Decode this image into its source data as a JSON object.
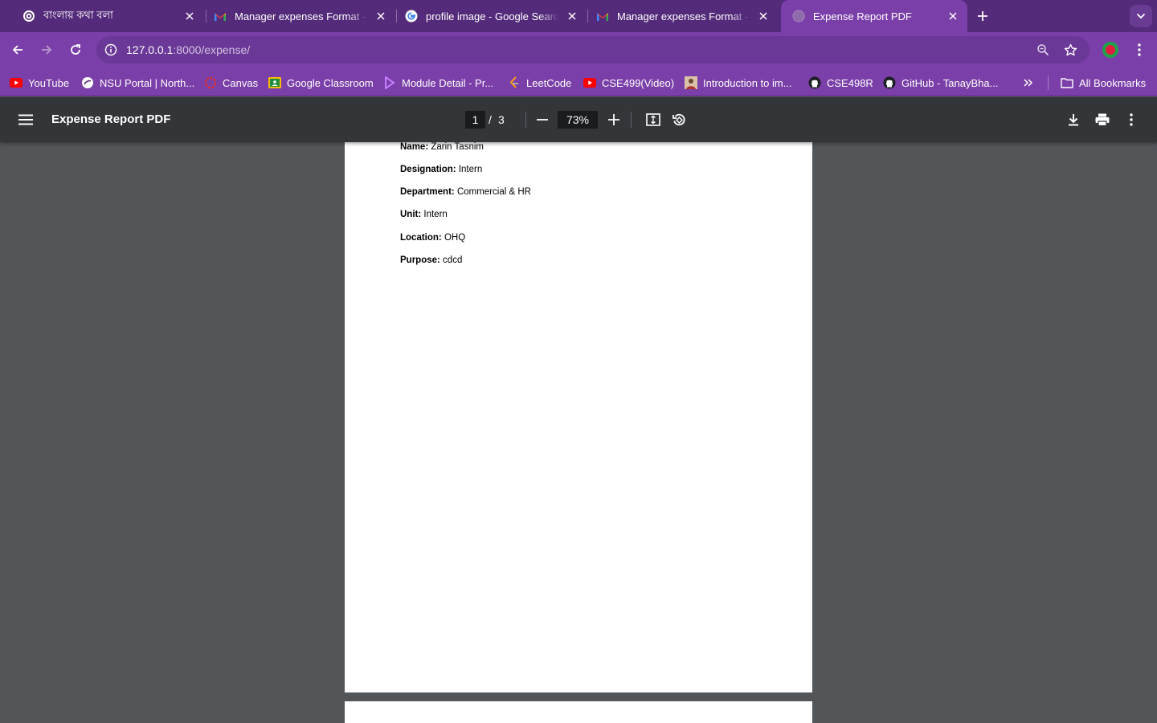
{
  "tabs": [
    {
      "title": "বাংলায় কথা বলা",
      "icon": "openai-icon",
      "active": false
    },
    {
      "title": "Manager expenses Format - p",
      "icon": "gmail-icon",
      "active": false
    },
    {
      "title": "profile image - Google Search",
      "icon": "google-icon",
      "active": false
    },
    {
      "title": "Manager expenses Format - p",
      "icon": "gmail-icon",
      "active": false
    },
    {
      "title": "Expense Report PDF",
      "icon": "globe-icon",
      "active": true
    }
  ],
  "address_bar": {
    "host": "127.0.0.1",
    "path": ":8000/expense/"
  },
  "bookmarks": [
    {
      "label": "YouTube",
      "icon": "youtube-icon"
    },
    {
      "label": "NSU Portal | North...",
      "icon": "nsu-icon"
    },
    {
      "label": "Canvas",
      "icon": "canvas-icon"
    },
    {
      "label": "Google Classroom",
      "icon": "classroom-icon"
    },
    {
      "label": "Module Detail - Pr...",
      "icon": "module-icon"
    },
    {
      "label": "LeetCode",
      "icon": "leetcode-icon"
    },
    {
      "label": "CSE499(Video)",
      "icon": "youtube-icon"
    },
    {
      "label": "Introduction to im...",
      "icon": "avatar-icon"
    },
    {
      "label": "CSE498R",
      "icon": "github-icon"
    },
    {
      "label": "GitHub - TanayBha...",
      "icon": "github-icon"
    }
  ],
  "all_bookmarks_label": "All Bookmarks",
  "pdf_viewer": {
    "title": "Expense Report PDF",
    "current_page": "1",
    "page_separator": "/",
    "total_pages": "3",
    "zoom": "73%"
  },
  "document": {
    "fields": [
      {
        "key": "Name:",
        "value": "Zarin Tasnim"
      },
      {
        "key": "Designation:",
        "value": "Intern"
      },
      {
        "key": "Department:",
        "value": "Commercial & HR"
      },
      {
        "key": "Unit:",
        "value": "Intern"
      },
      {
        "key": "Location:",
        "value": "OHQ"
      },
      {
        "key": "Purpose:",
        "value": "cdcd"
      }
    ]
  },
  "colors": {
    "tabstrip": "#542b7a",
    "toolbar": "#7a3fa8",
    "pdf_toolbar": "#323639",
    "pdf_background": "#525659"
  }
}
